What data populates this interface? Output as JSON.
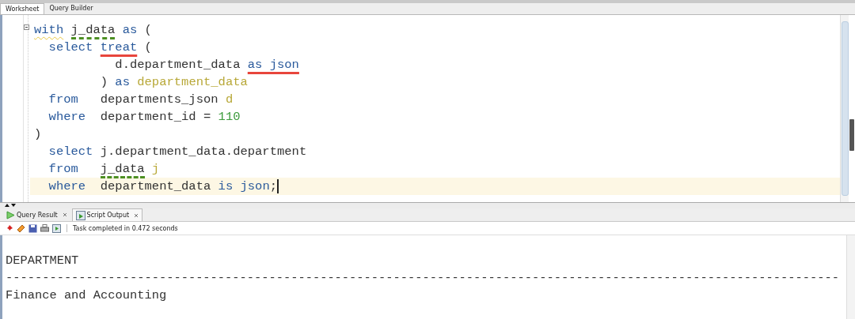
{
  "editor_tabs": [
    {
      "label": "Worksheet",
      "selected": true
    },
    {
      "label": "Query Builder",
      "selected": false
    }
  ],
  "editor": {
    "lines": [
      {
        "current": false,
        "tokens": [
          {
            "text": "with",
            "kind": "keyword",
            "misspelled": true
          },
          {
            "text": " j_data",
            "kind": "plain",
            "flagged": true
          },
          {
            "text": " as",
            "kind": "keyword"
          },
          {
            "text": " (",
            "kind": "plain"
          }
        ]
      },
      {
        "current": false,
        "tokens": [
          {
            "text": "  select",
            "kind": "keyword"
          },
          {
            "text": " treat",
            "kind": "keyword",
            "underlined": true
          },
          {
            "text": " (",
            "kind": "plain"
          }
        ]
      },
      {
        "current": false,
        "tokens": [
          {
            "text": "           d.department_data ",
            "kind": "plain"
          },
          {
            "text": "as json",
            "kind": "keyword",
            "underlined": true
          }
        ]
      },
      {
        "current": false,
        "tokens": [
          {
            "text": "         ) ",
            "kind": "plain"
          },
          {
            "text": "as ",
            "kind": "keyword"
          },
          {
            "text": "department_data",
            "kind": "alias"
          }
        ]
      },
      {
        "current": false,
        "tokens": [
          {
            "text": "  from",
            "kind": "keyword"
          },
          {
            "text": "   departments_json ",
            "kind": "plain"
          },
          {
            "text": "d",
            "kind": "alias"
          }
        ]
      },
      {
        "current": false,
        "tokens": [
          {
            "text": "  where",
            "kind": "keyword"
          },
          {
            "text": "  department_id = ",
            "kind": "plain"
          },
          {
            "text": "110",
            "kind": "number"
          }
        ]
      },
      {
        "current": false,
        "tokens": [
          {
            "text": ")",
            "kind": "plain"
          }
        ]
      },
      {
        "current": false,
        "tokens": [
          {
            "text": "  select",
            "kind": "keyword"
          },
          {
            "text": " j.department_data.department",
            "kind": "plain"
          }
        ]
      },
      {
        "current": false,
        "tokens": [
          {
            "text": "  from",
            "kind": "keyword"
          },
          {
            "text": "   j_data",
            "kind": "plain",
            "flagged": true
          },
          {
            "text": " j",
            "kind": "alias"
          }
        ]
      },
      {
        "current": true,
        "tokens": [
          {
            "text": "  where",
            "kind": "keyword"
          },
          {
            "text": "  department_data ",
            "kind": "plain"
          },
          {
            "text": "is json",
            "kind": "keyword"
          },
          {
            "text": ";",
            "kind": "plain"
          }
        ]
      }
    ]
  },
  "result_tabs": [
    {
      "label": "Query Result",
      "selected": false
    },
    {
      "label": "Script Output",
      "selected": true
    }
  ],
  "status": "Task completed in 0.472 seconds",
  "output": [
    "DEPARTMENT",
    "------------------------------------------------------------------------------------------------------------------",
    "Finance and Accounting"
  ]
}
